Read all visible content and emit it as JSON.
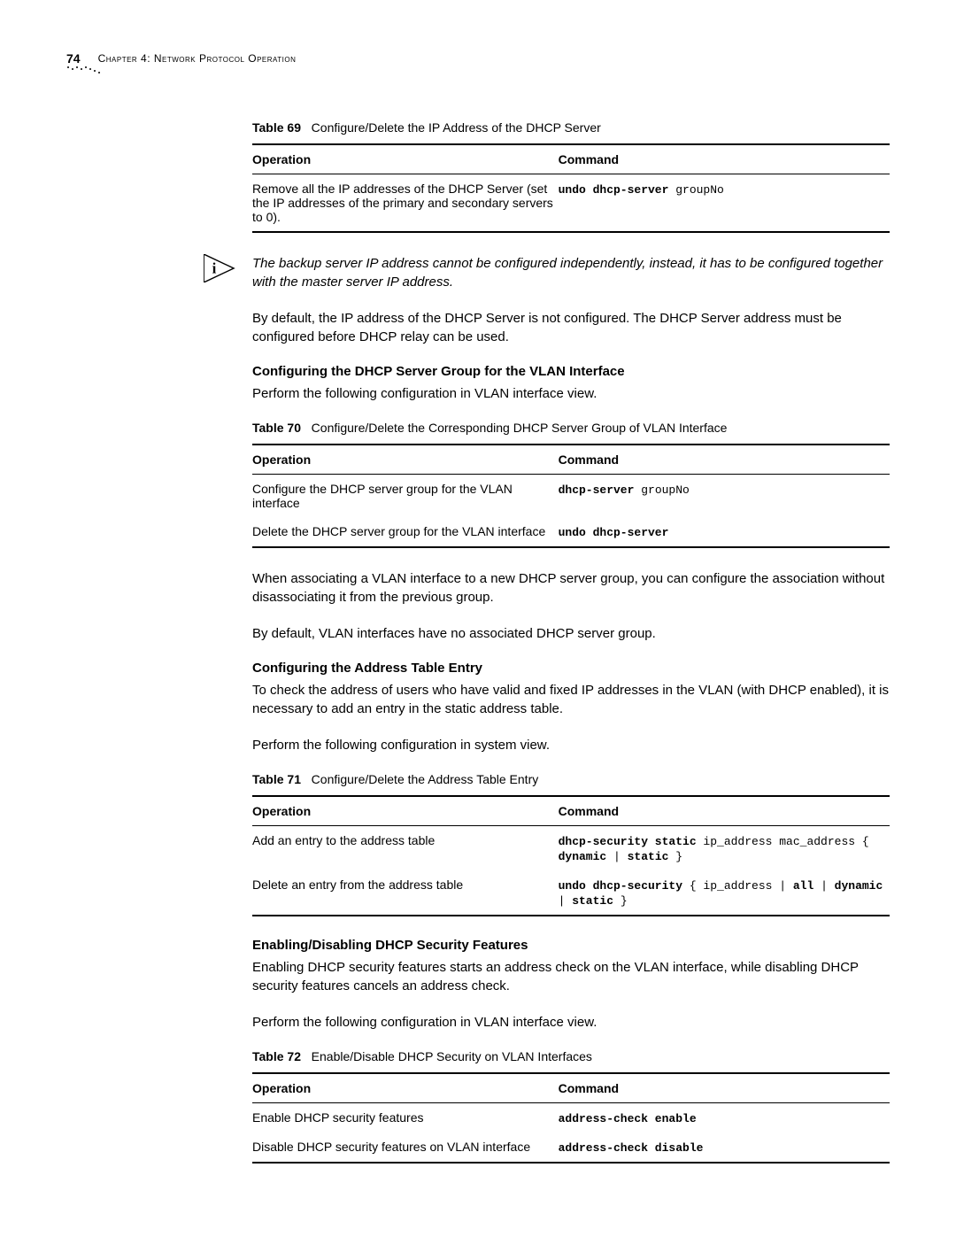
{
  "header": {
    "page_number": "74",
    "chapter": "Chapter 4: Network Protocol Operation"
  },
  "table69": {
    "title_label": "Table 69",
    "title_text": "Configure/Delete the IP Address of the DHCP Server",
    "col_op": "Operation",
    "col_cmd": "Command",
    "row1_op": "Remove all the IP addresses of the DHCP Server (set the IP addresses of the primary and secondary servers to 0).",
    "row1_cmd_bold": "undo dhcp-server",
    "row1_cmd_plain": " groupNo"
  },
  "note1": "The backup server IP address cannot be configured independently, instead, it has to be configured together with the master server IP address.",
  "para1": "By default, the IP address of the DHCP Server is not configured. The DHCP Server address must be configured before DHCP relay can be used.",
  "heading1": "Configuring the DHCP Server Group for the VLAN Interface",
  "para2": "Perform the following configuration in VLAN interface view.",
  "table70": {
    "title_label": "Table 70",
    "title_text": "Configure/Delete the Corresponding DHCP Server Group of VLAN Interface",
    "col_op": "Operation",
    "col_cmd": "Command",
    "row1_op": "Configure the DHCP server group for the VLAN interface",
    "row1_cmd_bold": "dhcp-server",
    "row1_cmd_plain": " groupNo",
    "row2_op": "Delete the DHCP server group for the VLAN interface",
    "row2_cmd_bold": "undo dhcp-server"
  },
  "para3": "When associating a VLAN interface to a new DHCP server group, you can configure the association without disassociating it from the previous group.",
  "para4": "By default, VLAN interfaces have no associated DHCP server group.",
  "heading2": "Configuring the Address Table Entry",
  "para5": "To check the address of users who have valid and fixed IP addresses in the VLAN (with DHCP enabled), it is necessary to add an entry in the static address table.",
  "para6": "Perform the following configuration in system view.",
  "table71": {
    "title_label": "Table 71",
    "title_text": "Configure/Delete the Address Table Entry",
    "col_op": "Operation",
    "col_cmd": "Command",
    "row1_op": "Add an entry to the address table",
    "row1_cmd_b1": "dhcp-security static",
    "row1_cmd_p1": " ip_address mac_address",
    "row1_cmd_p2": " { ",
    "row1_cmd_b2": "dynamic",
    "row1_cmd_p3": " | ",
    "row1_cmd_b3": "static",
    "row1_cmd_p4": " }",
    "row2_op": "Delete an entry from the address table",
    "row2_cmd_b1": "undo dhcp-security",
    "row2_cmd_p1": " { ip_address | ",
    "row2_cmd_b2": "all",
    "row2_cmd_p2": " | ",
    "row2_cmd_b3": "dynamic",
    "row2_cmd_p3": " | ",
    "row2_cmd_b4": "static",
    "row2_cmd_p4": " }"
  },
  "heading3": "Enabling/Disabling DHCP Security Features",
  "para7": "Enabling DHCP security features starts an address check on the VLAN interface, while disabling DHCP security features cancels an address check.",
  "para8": "Perform the following configuration in VLAN interface view.",
  "table72": {
    "title_label": "Table 72",
    "title_text": "Enable/Disable DHCP Security on VLAN Interfaces",
    "col_op": "Operation",
    "col_cmd": "Command",
    "row1_op": "Enable DHCP security features",
    "row1_cmd_bold": "address-check enable",
    "row2_op": "Disable DHCP security features on VLAN interface",
    "row2_cmd_bold": "address-check disable"
  }
}
